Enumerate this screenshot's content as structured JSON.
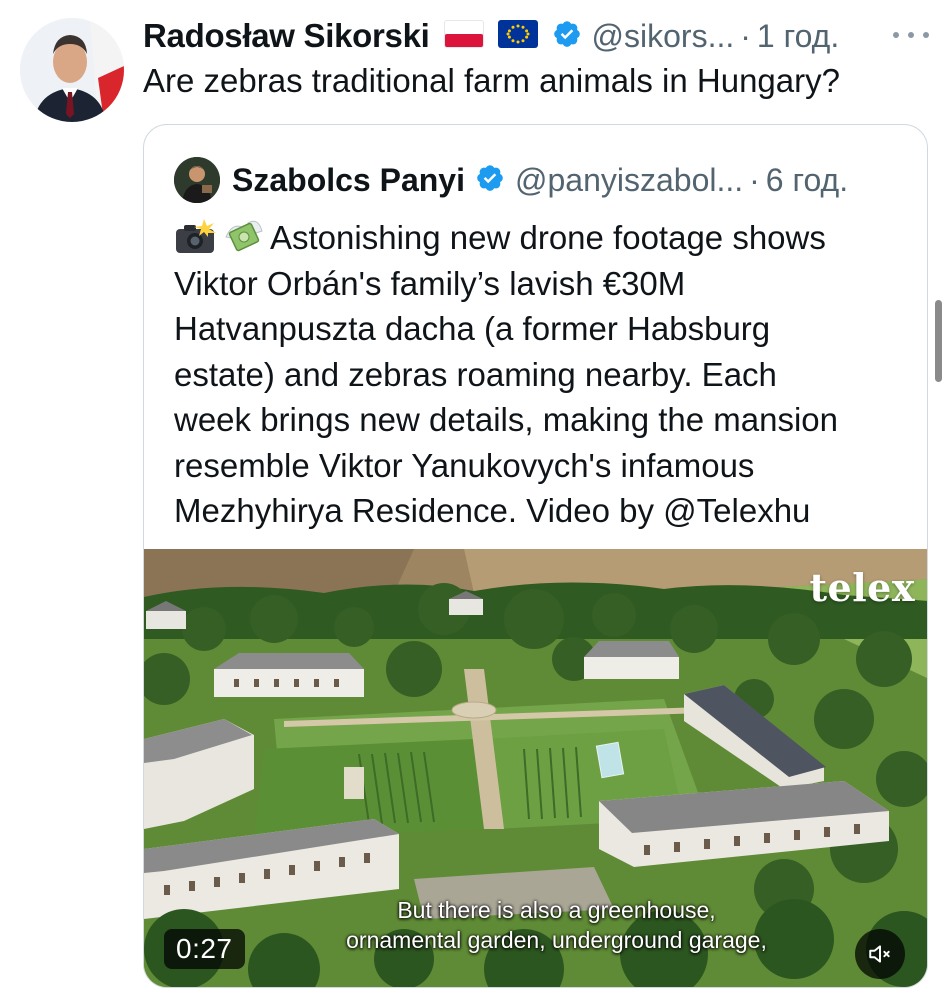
{
  "tweet": {
    "author_name": "Radosław Sikorski",
    "handle": "@sikors...",
    "separator": "·",
    "time": "1 год.",
    "text": "Are zebras traditional farm animals in Hungary?",
    "flags": [
      "poland-flag-icon",
      "eu-flag-icon"
    ],
    "more_icon": "more-dots-icon"
  },
  "quote": {
    "author_name": "Szabolcs Panyi",
    "handle": "@panyiszabol...",
    "separator": "·",
    "time": "6 год.",
    "emojis": [
      "camera-flash-icon",
      "money-wings-icon"
    ],
    "lines": [
      "Astonishing new drone footage shows",
      "Viktor Orbán's family’s lavish €30M",
      "Hatvanpuszta dacha (a former Habsburg",
      "estate) and zebras roaming nearby. Each",
      "week brings new details, making the mansion",
      "resemble Viktor Yanukovych's infamous",
      "Mezhyhirya Residence. Video by @Telexhu"
    ],
    "media": {
      "watermark": "telex",
      "subtitle_line1": "But there is also a greenhouse,",
      "subtitle_line2": "ornamental garden, underground garage,",
      "duration": "0:27",
      "mute_icon": "muted-speaker-icon"
    }
  },
  "colors": {
    "text": "#0f1419",
    "secondary": "#536471",
    "verified": "#1d9bf0",
    "border": "#cfd9de"
  }
}
